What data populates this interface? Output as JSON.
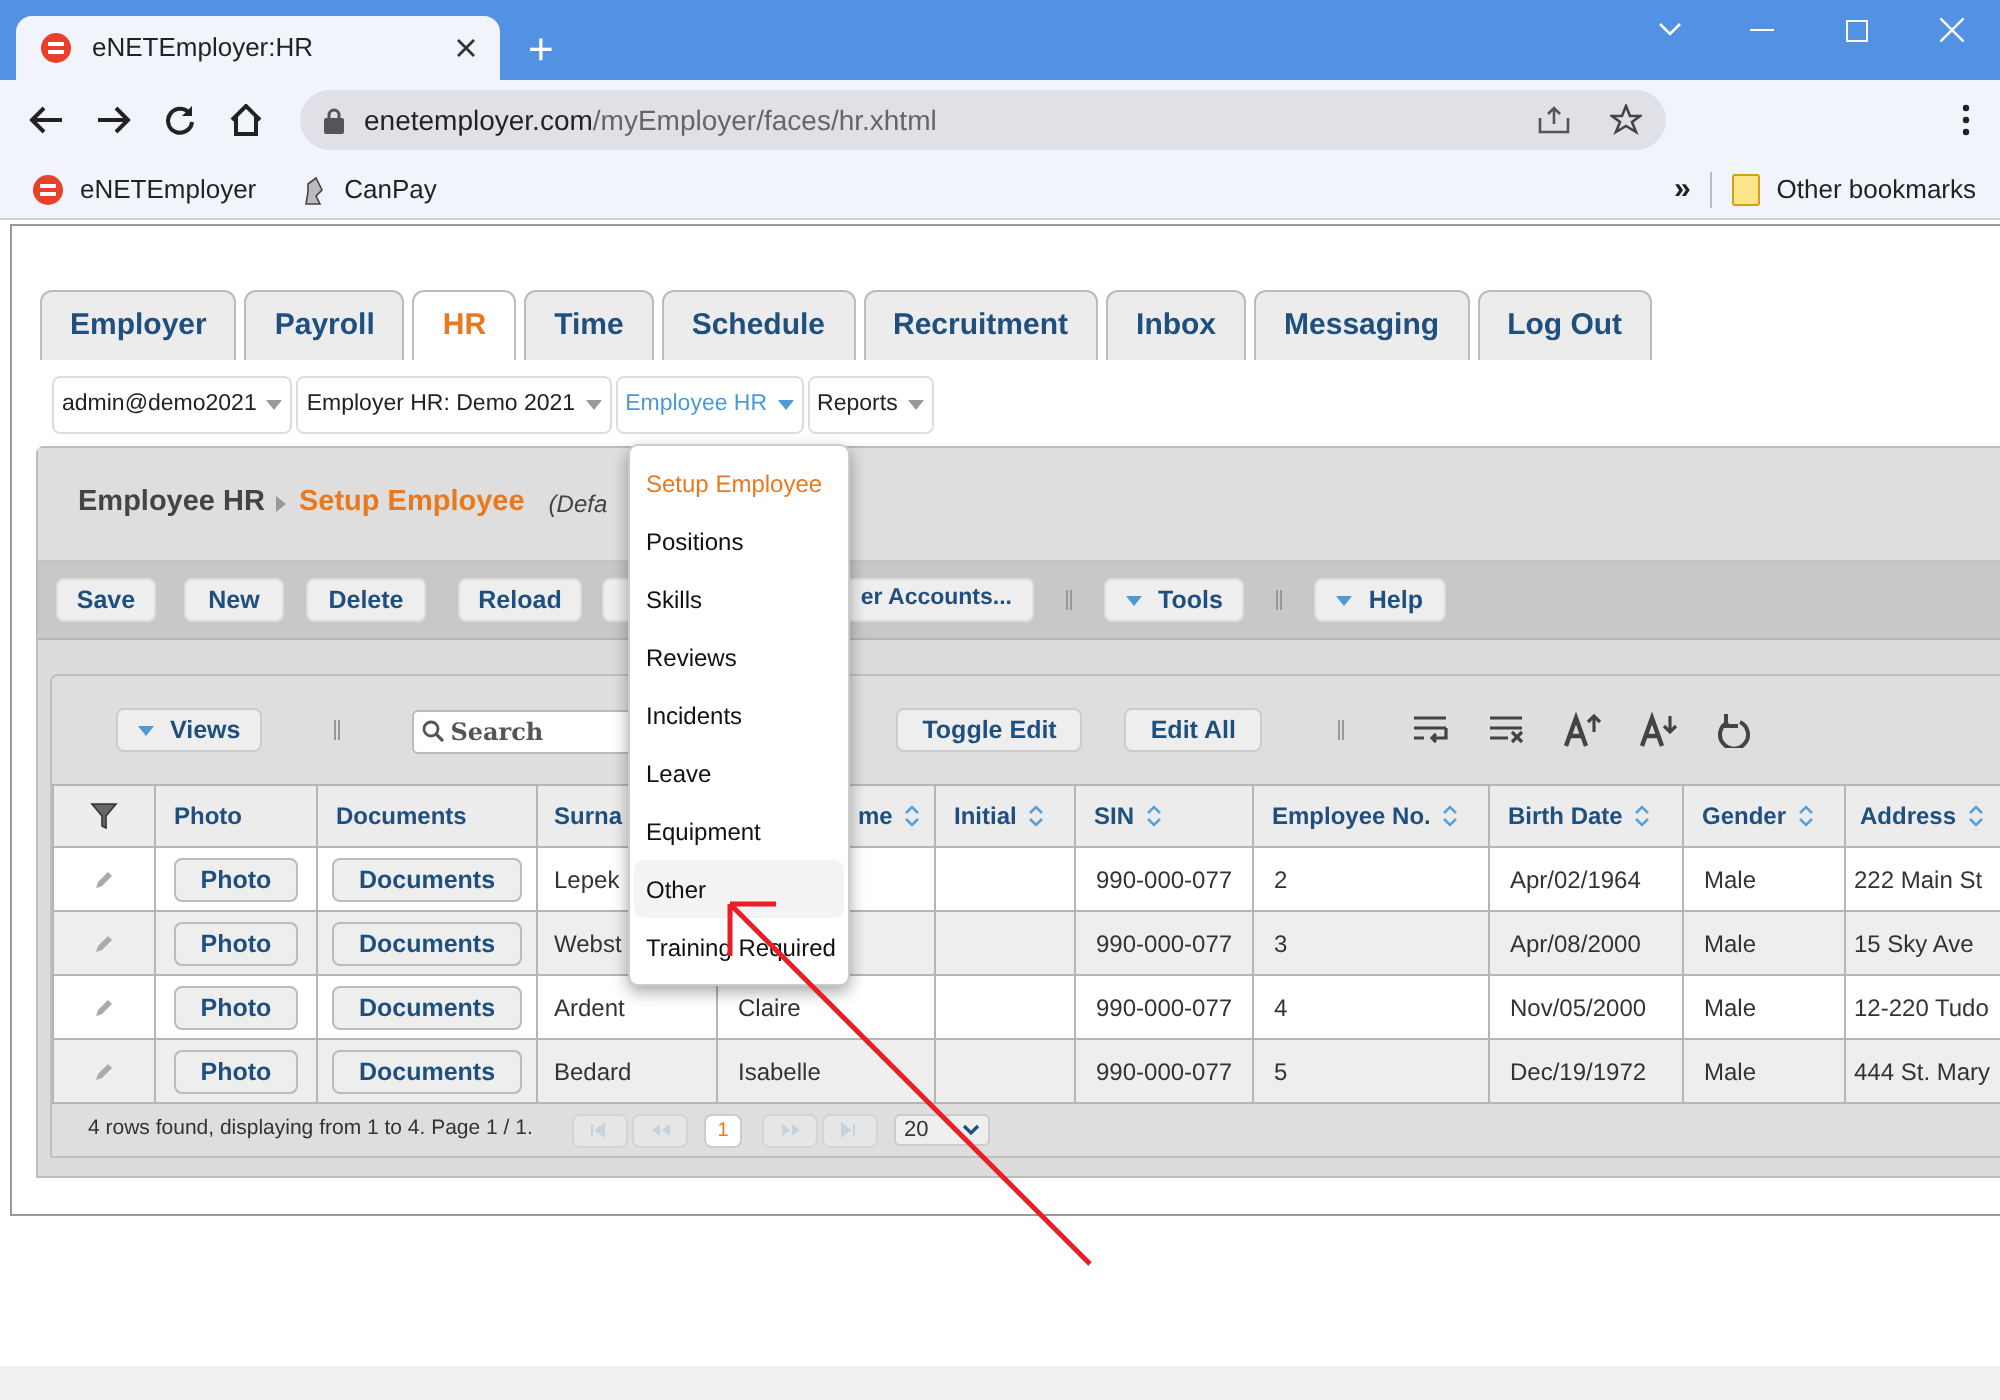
{
  "browser": {
    "tab_title": "eNETEmployer:HR",
    "new_tab": "+",
    "url_host": "enetemployer.com",
    "url_path": "/myEmployer/faces/hr.xhtml",
    "bookmarks": [
      {
        "label": "eNETEmployer"
      },
      {
        "label": "CanPay"
      }
    ],
    "overflow": "»",
    "other_bookmarks": "Other bookmarks"
  },
  "tabs": [
    {
      "label": "Employer",
      "selected": false
    },
    {
      "label": "Payroll",
      "selected": false
    },
    {
      "label": "HR",
      "selected": true
    },
    {
      "label": "Time",
      "selected": false
    },
    {
      "label": "Schedule",
      "selected": false
    },
    {
      "label": "Recruitment",
      "selected": false
    },
    {
      "label": "Inbox",
      "selected": false
    },
    {
      "label": "Messaging",
      "selected": false
    },
    {
      "label": "Log Out",
      "selected": false
    }
  ],
  "menu_bar": [
    {
      "label": "admin@demo2021",
      "open": false
    },
    {
      "label": "Employer HR: Demo 2021",
      "open": false
    },
    {
      "label": "Employee HR",
      "open": true
    },
    {
      "label": "Reports",
      "open": false
    }
  ],
  "dropdown": [
    {
      "label": "Setup Employee",
      "selected": true,
      "hovered": false
    },
    {
      "label": "Positions",
      "selected": false,
      "hovered": false
    },
    {
      "label": "Skills",
      "selected": false,
      "hovered": false
    },
    {
      "label": "Reviews",
      "selected": false,
      "hovered": false
    },
    {
      "label": "Incidents",
      "selected": false,
      "hovered": false
    },
    {
      "label": "Leave",
      "selected": false,
      "hovered": false
    },
    {
      "label": "Equipment",
      "selected": false,
      "hovered": false
    },
    {
      "label": "Other",
      "selected": false,
      "hovered": true
    },
    {
      "label": "Training Required",
      "selected": false,
      "hovered": false
    }
  ],
  "breadcrumb": {
    "section": "Employee HR",
    "page": "Setup Employee",
    "note": "(Defa"
  },
  "toolbar": [
    {
      "label": "Save",
      "kind": "button"
    },
    {
      "label": "New",
      "kind": "button"
    },
    {
      "label": "Delete",
      "kind": "button"
    },
    {
      "label": "Reload",
      "kind": "button"
    },
    {
      "label": "er Accounts...",
      "kind": "cut"
    },
    {
      "kind": "separator"
    },
    {
      "label": "Tools",
      "kind": "menu"
    },
    {
      "kind": "separator"
    },
    {
      "label": "Help",
      "kind": "menu"
    }
  ],
  "grid_toolbar": {
    "views": "Views",
    "search_placeholder": "Search",
    "toggle_edit": "Toggle Edit",
    "edit_all": "Edit All"
  },
  "table": {
    "columns": [
      {
        "label": "Photo",
        "sortable": false
      },
      {
        "label": "Documents",
        "sortable": false
      },
      {
        "label": "Surna",
        "sortable": false
      },
      {
        "label": "me",
        "sortable": true
      },
      {
        "label": "Initial",
        "sortable": true
      },
      {
        "label": "SIN",
        "sortable": true
      },
      {
        "label": "Employee No.",
        "sortable": true
      },
      {
        "label": "Birth Date",
        "sortable": true
      },
      {
        "label": "Gender",
        "sortable": true
      },
      {
        "label": "Address",
        "sortable": true
      }
    ],
    "rows": [
      {
        "photo": "Photo",
        "documents": "Documents",
        "surname": "Lepek",
        "sin": "990-000-077",
        "employee_no": "2",
        "birth_date": "Apr/02/1964",
        "gender": "Male",
        "address": "222 Main St"
      },
      {
        "photo": "Photo",
        "documents": "Documents",
        "surname": "Webst",
        "sin": "990-000-077",
        "employee_no": "3",
        "birth_date": "Apr/08/2000",
        "gender": "Male",
        "address": "15 Sky Ave"
      },
      {
        "photo": "Photo",
        "documents": "Documents",
        "surname": "Ardent",
        "first_name": "Claire",
        "sin": "990-000-077",
        "employee_no": "4",
        "birth_date": "Nov/05/2000",
        "gender": "Male",
        "address": "12-220 Tudo"
      },
      {
        "photo": "Photo",
        "documents": "Documents",
        "surname": "Bedard",
        "first_name": "Isabelle",
        "sin": "990-000-077",
        "employee_no": "5",
        "birth_date": "Dec/19/1972",
        "gender": "Male",
        "address": "444 St. Mary"
      }
    ],
    "footer": "4 rows found, displaying from 1 to 4. Page 1 / 1.",
    "page": "1",
    "page_size": "20"
  }
}
